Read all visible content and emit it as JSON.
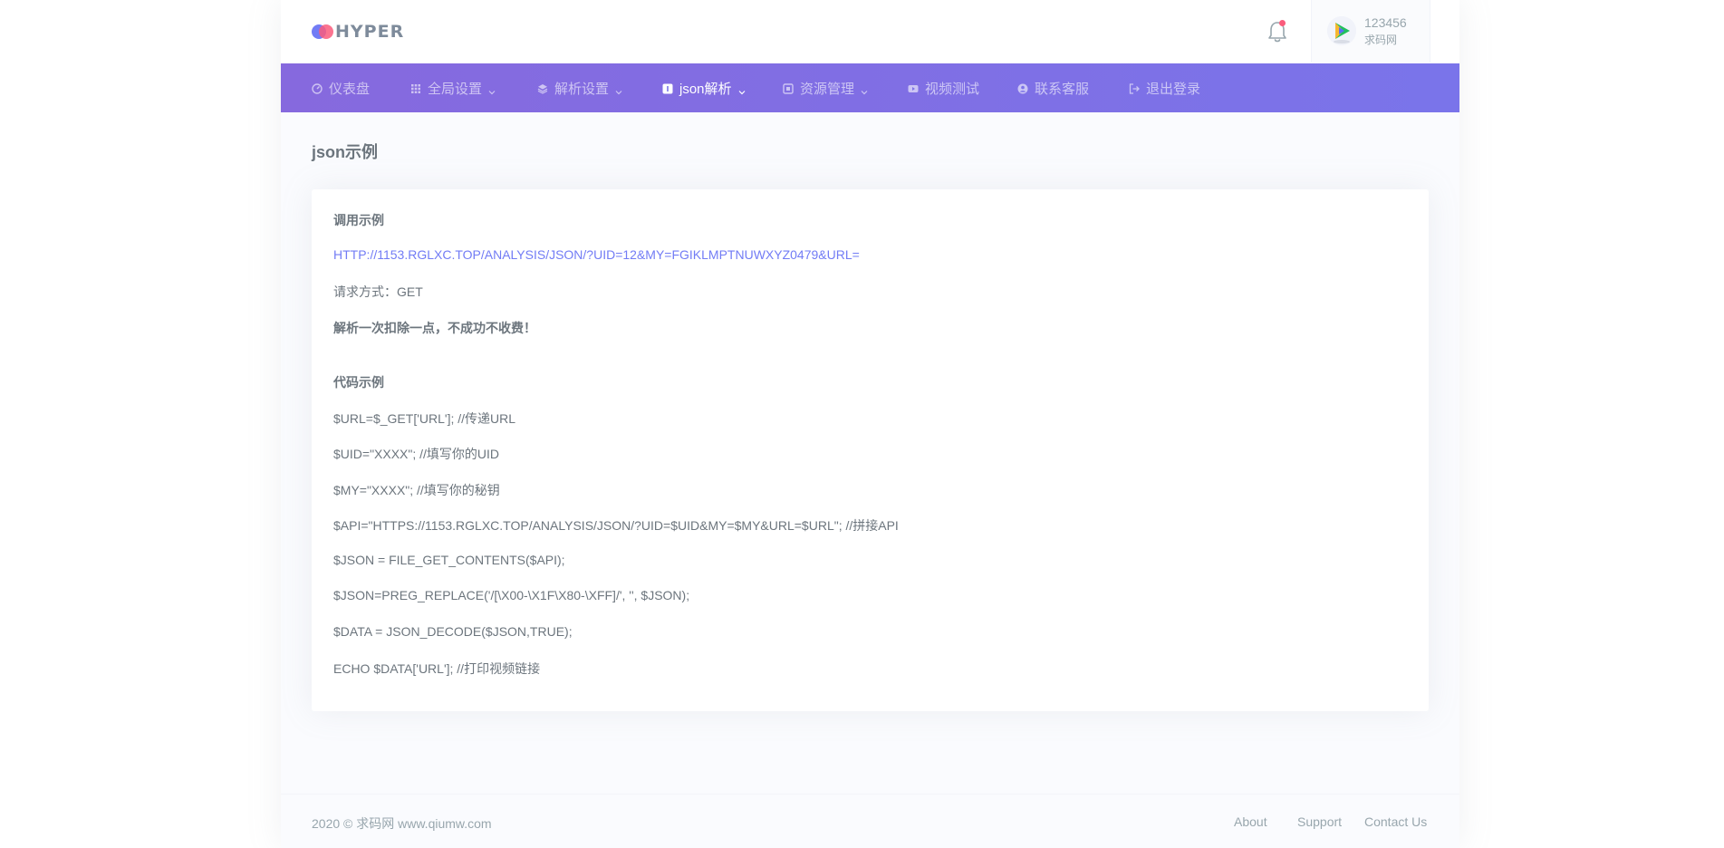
{
  "header": {
    "logo_text": "HYPER",
    "user": {
      "name": "123456",
      "subtitle": "求码网"
    }
  },
  "nav": {
    "items": [
      {
        "label": "仪表盘",
        "icon": "speedometer-icon",
        "has_dropdown": false,
        "active": false
      },
      {
        "label": "全局设置",
        "icon": "grid-icon",
        "has_dropdown": true,
        "active": false
      },
      {
        "label": "解析设置",
        "icon": "layers-icon",
        "has_dropdown": true,
        "active": false
      },
      {
        "label": "json解析",
        "icon": "info-square-icon",
        "has_dropdown": true,
        "active": true
      },
      {
        "label": "资源管理",
        "icon": "apps-icon",
        "has_dropdown": true,
        "active": false
      },
      {
        "label": "视频测试",
        "icon": "youtube-icon",
        "has_dropdown": false,
        "active": false
      },
      {
        "label": "联系客服",
        "icon": "user-circle-icon",
        "has_dropdown": false,
        "active": false
      },
      {
        "label": "退出登录",
        "icon": "logout-icon",
        "has_dropdown": false,
        "active": false
      }
    ]
  },
  "page": {
    "title": "json示例"
  },
  "card": {
    "call_example_heading": "调用示例",
    "call_url": "HTTP://1153.RGLXC.TOP/ANALYSIS/JSON/?UID=12&MY=FGIKLMPTNUWXYZ0479&URL=",
    "request_method": "请求方式：GET",
    "billing_note": "解析一次扣除一点，不成功不收费！",
    "code_example_heading": "代码示例",
    "code_lines": [
      "$URL=$_GET['URL']; //传递URL",
      "$UID=\"XXXX\"; //填写你的UID",
      "$MY=\"XXXX\"; //填写你的秘钥",
      "$API=\"HTTPS://1153.RGLXC.TOP/ANALYSIS/JSON/?UID=$UID&MY=$MY&URL=$URL\"; //拼接API",
      "$JSON = FILE_GET_CONTENTS($API);",
      "$JSON=PREG_REPLACE('/[\\X00-\\X1F\\X80-\\XFF]/', '', $JSON);",
      "$DATA = JSON_DECODE($JSON,TRUE);",
      "ECHO $DATA['URL']; //打印视频链接"
    ]
  },
  "footer": {
    "copyright": "2020 © 求码网 www.qiumw.com",
    "links": [
      "About",
      "Support",
      "Contact Us"
    ]
  },
  "colors": {
    "accent": "#727cf5",
    "nav_gradient_start": "#8669de",
    "nav_gradient_end": "#7a74ea",
    "badge": "#fa5c7c"
  }
}
